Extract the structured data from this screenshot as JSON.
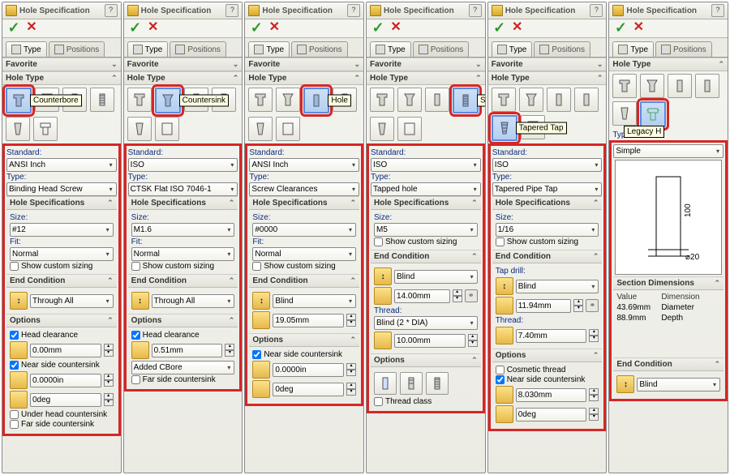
{
  "title": "Hole Specification",
  "tabs": {
    "type": "Type",
    "positions": "Positions"
  },
  "sections": {
    "favorite": "Favorite",
    "hole_type": "Hole Type",
    "hole_specifications": "Hole Specifications",
    "end_condition": "End Condition",
    "options": "Options",
    "section_dimensions": "Section Dimensions"
  },
  "labels": {
    "standard": "Standard:",
    "type": "Type:",
    "size": "Size:",
    "fit": "Fit:",
    "thread": "Thread:",
    "tap_drill": "Tap drill:",
    "value": "Value",
    "dimension": "Dimension"
  },
  "checks": {
    "show_custom_sizing": "Show custom sizing",
    "head_clearance": "Head clearance",
    "near_side_countersink": "Near side countersink",
    "under_head_countersink": "Under head countersink",
    "far_side_countersink": "Far side countersink",
    "cosmetic_thread": "Cosmetic thread",
    "thread_class": "Thread class"
  },
  "tooltips": {
    "counterbore": "Counterbore",
    "countersink": "Countersink",
    "hole": "Hole",
    "straight_tap": "Straight Tap",
    "tapered_tap": "Tapered Tap",
    "legacy": "Legacy H"
  },
  "panels": [
    {
      "standard": "ANSI Inch",
      "type": "Binding Head Screw",
      "size": "#12",
      "fit": "Normal",
      "end_condition": "Through All",
      "opts": {
        "head_clearance": "0.00mm",
        "csk_dia": "0.0000in",
        "csk_ang": "0deg"
      }
    },
    {
      "standard": "ISO",
      "type": "CTSK Flat ISO 7046-1",
      "size": "M1.6",
      "fit": "Normal",
      "end_condition": "Through All",
      "opts": {
        "head_clearance": "0.51mm",
        "added_cbore": "Added CBore"
      }
    },
    {
      "standard": "ANSI Inch",
      "type": "Screw Clearances",
      "size": "#0000",
      "fit": "Normal",
      "end_condition": "Blind",
      "depth": "19.05mm",
      "opts": {
        "csk_dia": "0.0000in",
        "csk_ang": "0deg"
      }
    },
    {
      "standard": "ISO",
      "type": "Tapped hole",
      "size": "M5",
      "end_condition": "Blind",
      "depth": "14.00mm",
      "thread": "Blind (2 * DIA)",
      "thread_depth": "10.00mm"
    },
    {
      "standard": "ISO",
      "type": "Tapered Pipe Tap",
      "size": "1/16",
      "tap_drill": "Blind",
      "tap_depth": "11.94mm",
      "thread_v": "7.40mm",
      "opts": {
        "csk_dia": "8.030mm",
        "csk_ang": "0deg"
      }
    },
    {
      "type": "Simple",
      "dims": [
        {
          "value": "43.69mm",
          "dimension": "Diameter"
        },
        {
          "value": "88.9mm",
          "dimension": "Depth"
        }
      ],
      "preview": {
        "h": "100",
        "d": "⌀20"
      },
      "end_condition": "Blind"
    }
  ]
}
